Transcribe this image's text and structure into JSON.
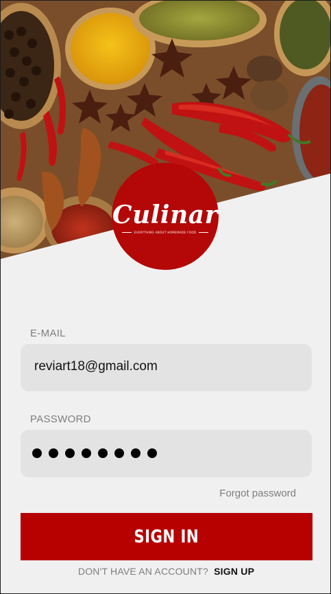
{
  "brand": {
    "name": "Culinar",
    "tagline": "EVERYTHING ABOUT HOMEMADE FOOD",
    "accent_color": "#b40707"
  },
  "hero": {
    "image": "spices-background-photo"
  },
  "form": {
    "email": {
      "label": "E-MAIL",
      "value": "reviart18@gmail.com"
    },
    "password": {
      "label": "PASSWORD",
      "masked_length": 8
    },
    "forgot_password": "Forgot password",
    "sign_in": "SIGN IN"
  },
  "footer": {
    "question": "DON'T HAVE AN ACCOUNT?",
    "sign_up": "SIGN UP"
  },
  "colors": {
    "button": "#b70000",
    "field_background": "#e3e3e3",
    "label": "#7d7d7d",
    "page_background": "#f0f0f0"
  }
}
